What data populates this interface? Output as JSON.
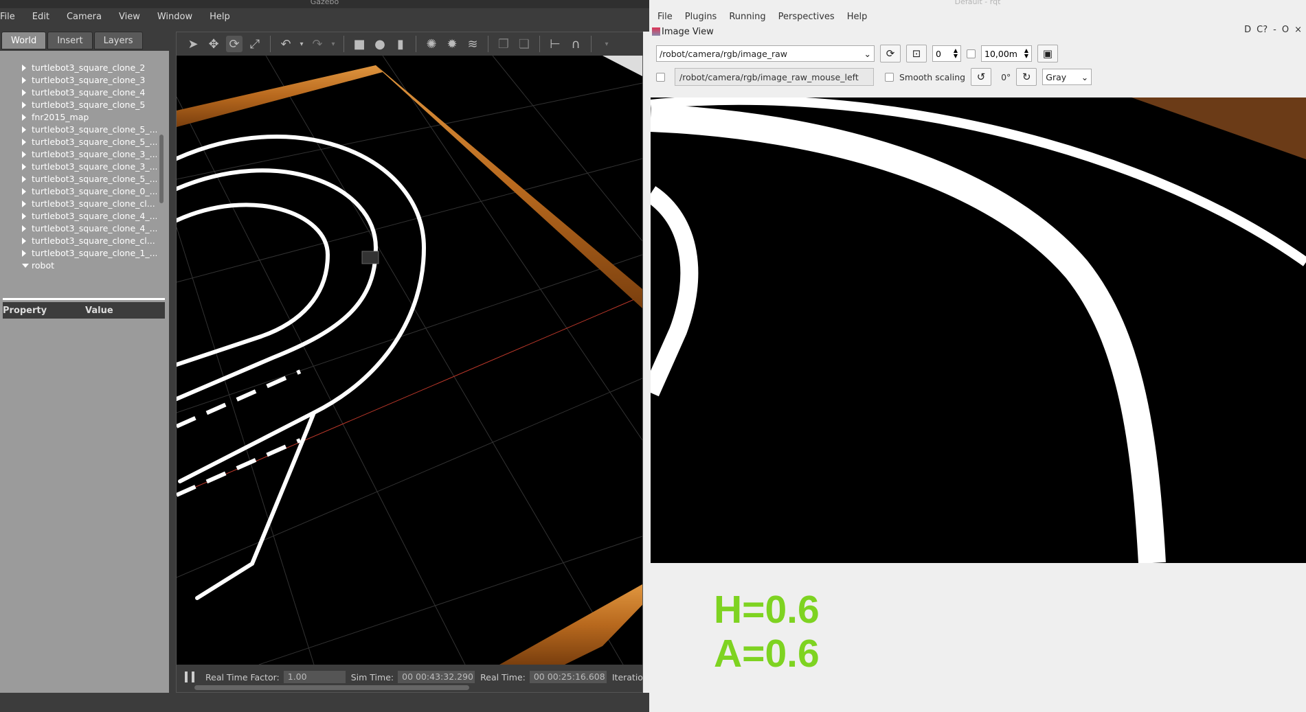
{
  "gazebo": {
    "title": "Gazebo",
    "menu": [
      "File",
      "Edit",
      "Camera",
      "View",
      "Window",
      "Help"
    ],
    "tabs": [
      "World",
      "Insert",
      "Layers"
    ],
    "tree": [
      "turtlebot3_square_clone_2",
      "turtlebot3_square_clone_3",
      "turtlebot3_square_clone_4",
      "turtlebot3_square_clone_5",
      "fnr2015_map",
      "turtlebot3_square_clone_5_...",
      "turtlebot3_square_clone_5_...",
      "turtlebot3_square_clone_3_...",
      "turtlebot3_square_clone_3_...",
      "turtlebot3_square_clone_5_...",
      "turtlebot3_square_clone_0_...",
      "turtlebot3_square_clone_cl...",
      "turtlebot3_square_clone_4_...",
      "turtlebot3_square_clone_4_...",
      "turtlebot3_square_clone_cl...",
      "turtlebot3_square_clone_1_...",
      "robot"
    ],
    "prop_header": {
      "property": "Property",
      "value": "Value"
    },
    "status": {
      "rtf_label": "Real Time Factor:",
      "rtf_value": "1.00",
      "sim_label": "Sim Time:",
      "sim_value": "00 00:43:32.290",
      "real_label": "Real Time:",
      "real_value": "00 00:25:16.608",
      "iter_label": "Iteration"
    }
  },
  "rqt": {
    "title": "Default - rqt",
    "menu": [
      "File",
      "Plugins",
      "Running",
      "Perspectives",
      "Help"
    ],
    "dock_title": "Image View",
    "dock_buttons": [
      "D",
      "C?",
      "-",
      "O",
      "×"
    ],
    "topic": "/robot/camera/rgb/image_raw",
    "spin_value": "0",
    "distance": "10,00m",
    "mouse_topic": "/robot/camera/rgb/image_raw_mouse_left",
    "smooth_label": "Smooth scaling",
    "rotation": "0°",
    "color_scheme": "Gray",
    "h_text": "H=0.6",
    "a_text": "A=0.6"
  }
}
